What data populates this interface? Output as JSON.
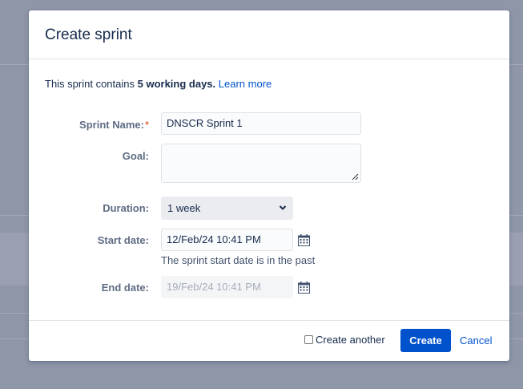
{
  "dialog": {
    "title": "Create sprint",
    "intro_prefix": "This sprint contains ",
    "intro_bold": "5 working days.",
    "learn_more": "Learn more"
  },
  "fields": {
    "sprint_name": {
      "label": "Sprint Name:",
      "required_marker": "*",
      "value": "DNSCR Sprint 1"
    },
    "goal": {
      "label": "Goal:",
      "value": ""
    },
    "duration": {
      "label": "Duration:",
      "selected": "1 week"
    },
    "start_date": {
      "label": "Start date:",
      "value": "12/Feb/24 10:41 PM",
      "hint": "The sprint start date is in the past"
    },
    "end_date": {
      "label": "End date:",
      "value": "19/Feb/24 10:41 PM"
    }
  },
  "footer": {
    "create_another": "Create another",
    "create": "Create",
    "cancel": "Cancel"
  },
  "colors": {
    "primary": "#0052cc",
    "required": "#de350b",
    "overlay": "#8f96a8"
  },
  "icons": {
    "calendar": "calendar-icon",
    "chevron": "chevron-down-icon"
  }
}
